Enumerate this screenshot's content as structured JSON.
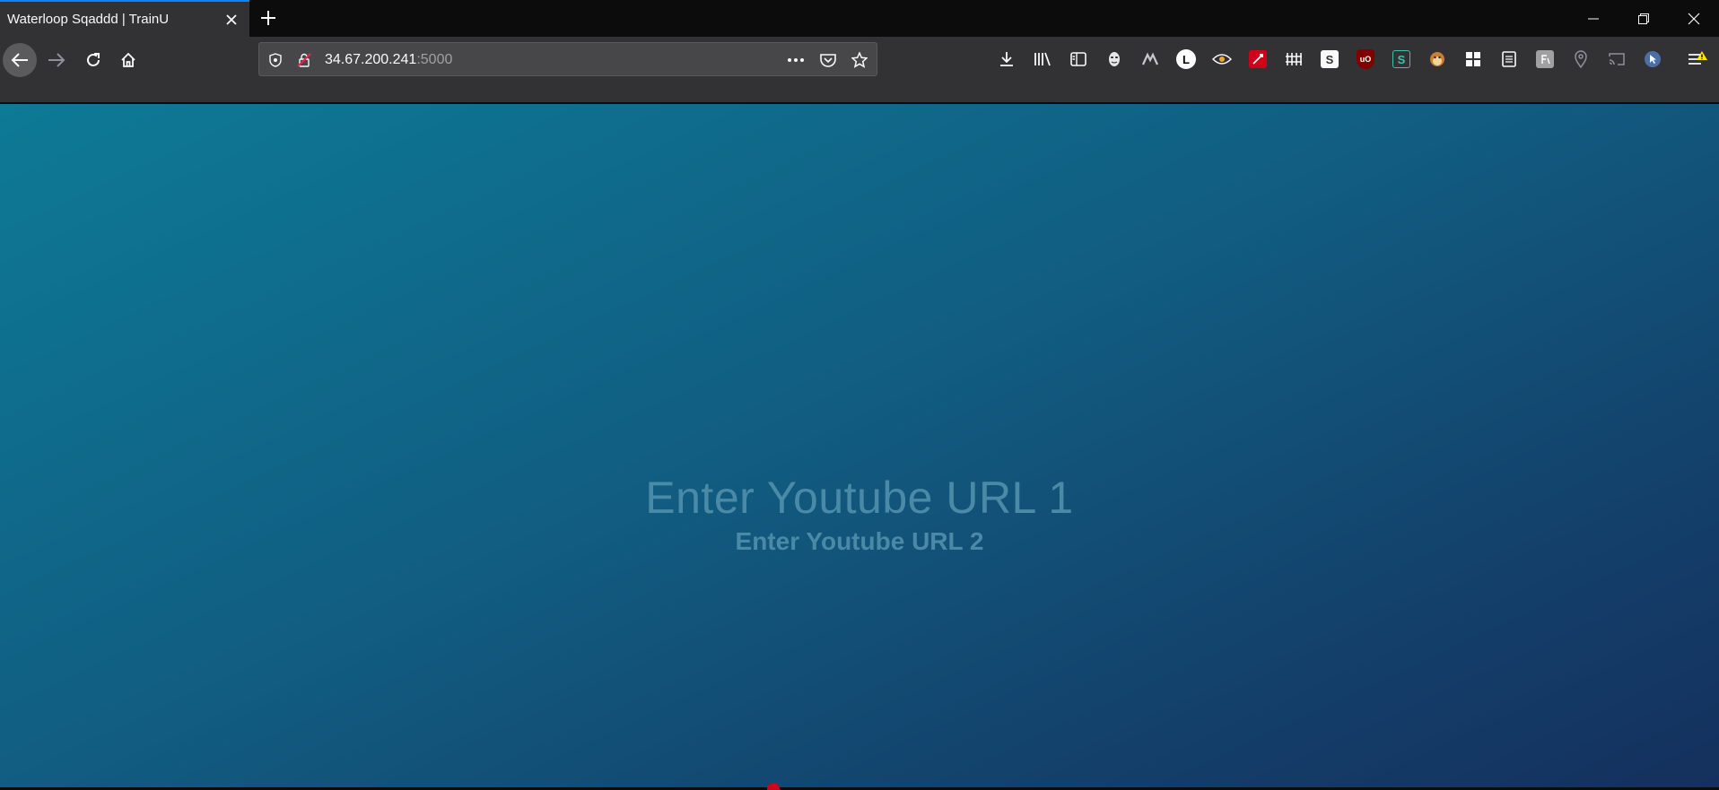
{
  "browser": {
    "tab": {
      "title": "Waterloop Sqaddd | TrainU"
    },
    "url": {
      "host": "34.67.200.241",
      "port": ":5000"
    },
    "extensions": [
      "download-icon",
      "library-icon",
      "sidebar-icon",
      "mask-icon",
      "vpn-icon",
      "L",
      "eye-icon",
      "fire-icon",
      "grid-icon",
      "S",
      "uO",
      "S",
      "monkey-icon",
      "apps-icon",
      "notes-icon",
      "translate-icon",
      "location-icon",
      "cast-icon",
      "pointer-icon"
    ],
    "extension_letters": {
      "l": "L",
      "s1": "S",
      "ud": "uO",
      "s2": "S"
    }
  },
  "page": {
    "heading_1": "Enter Youtube URL 1",
    "heading_2": "Enter Youtube URL 2"
  },
  "colors": {
    "tab_accent": "#0a84ff",
    "gradient_start": "#0d7a96",
    "gradient_end": "#15305d"
  }
}
